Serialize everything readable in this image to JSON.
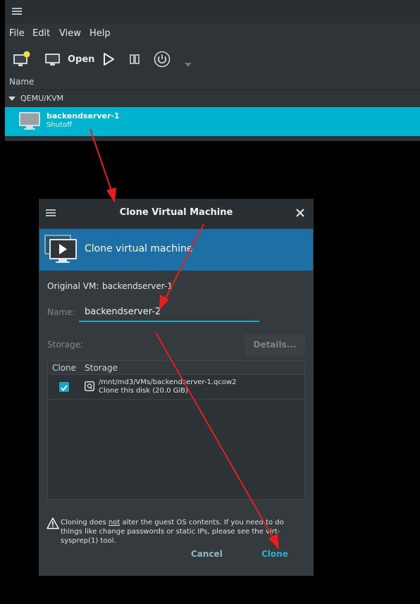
{
  "main_window": {
    "menu": [
      "File",
      "Edit",
      "View",
      "Help"
    ],
    "toolbar": {
      "open_label": "Open"
    },
    "list_header": "Name",
    "group": "QEMU/KVM",
    "vm": {
      "name": "backendserver-1",
      "status": "Shutoff"
    }
  },
  "dialog": {
    "title": "Clone Virtual Machine",
    "banner": "Clone virtual machine",
    "original_vm_label": "Original VM:",
    "original_vm_value": "backendserver-1",
    "name_label": "Name:",
    "name_value": "backendserver-2",
    "storage_label": "Storage:",
    "details_button": "Details...",
    "table": {
      "headers": [
        "Clone",
        "Storage"
      ],
      "rows": [
        {
          "checked": true,
          "path": "/mnt/md3/VMs/backendserver-1.qcow2",
          "desc": "Clone this disk (20.0 GiB)"
        }
      ]
    },
    "warning": {
      "pre": "Cloning does ",
      "emph": "not",
      "post": " alter the guest OS contents. If you need to do things like change passwords or static IPs, please see the virt-sysprep(1) tool."
    },
    "cancel_button": "Cancel",
    "clone_button": "Clone"
  },
  "colors": {
    "selection": "#00b4d0",
    "banner": "#1e6fa5",
    "accent": "#1aa6c8",
    "annotation_arrow": "#e61e1e"
  },
  "icons": [
    "hamburger-icon",
    "new-vm-icon",
    "monitor-icon",
    "play-icon",
    "pause-icon",
    "power-icon",
    "dropdown-arrow-icon",
    "expander-icon",
    "vm-monitor-icon",
    "clone-vm-icon",
    "close-icon",
    "checkbox-icon",
    "disk-icon",
    "warning-icon"
  ]
}
